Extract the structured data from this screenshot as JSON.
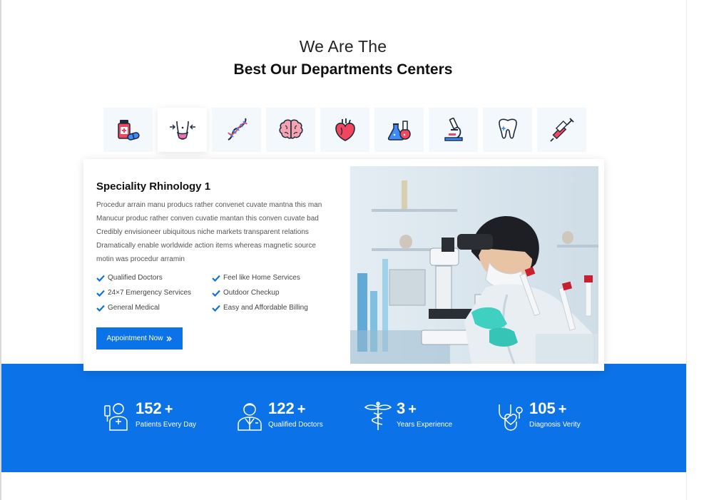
{
  "header": {
    "subtitle": "We Are The",
    "title": "Best Our Departments Centers"
  },
  "departments": {
    "tabs": [
      {
        "icon": "pills-icon"
      },
      {
        "icon": "abdomen-icon",
        "active": true
      },
      {
        "icon": "dna-icon"
      },
      {
        "icon": "brain-icon"
      },
      {
        "icon": "heart-icon"
      },
      {
        "icon": "flasks-icon"
      },
      {
        "icon": "microscope-icon"
      },
      {
        "icon": "tooth-icon"
      },
      {
        "icon": "syringe-icon"
      }
    ]
  },
  "detail": {
    "title": "Speciality Rhinology 1",
    "description": "Procedur arrain manu producs rather convenet cuvate mantna this man Manucur produc rather conven cuvatie mantan this conven cuvate bad Credibly envisioneer ubiquitous niche markets transparent relations Dramatically enable worldwide action items whereas magnetic source motin was procedur arramin",
    "features": [
      "Qualified Doctors",
      "Feel like Home Services",
      "24×7 Emergency Services",
      "Outdoor Checkup",
      "General Medical",
      "Easy and Affordable Billing"
    ],
    "button_label": "Appointment Now",
    "button_icon": "double-chevron-right-icon"
  },
  "stats": [
    {
      "number": "152",
      "suffix": "+",
      "label": "Patients Every Day",
      "icon": "patient-icon"
    },
    {
      "number": "122",
      "suffix": "+",
      "label": "Qualified Doctors",
      "icon": "doctor-icon"
    },
    {
      "number": "3",
      "suffix": "+",
      "label": "Years Experience",
      "icon": "caduceus-icon"
    },
    {
      "number": "105",
      "suffix": "+",
      "label": "Diagnosis Verity",
      "icon": "stethoscope-heart-icon"
    }
  ],
  "colors": {
    "accent": "#0b72e7",
    "tab_bg": "#f3f8fd",
    "icon_red": "#f0475e",
    "icon_blue": "#3d8bfd",
    "icon_dark": "#1c2a3a"
  }
}
